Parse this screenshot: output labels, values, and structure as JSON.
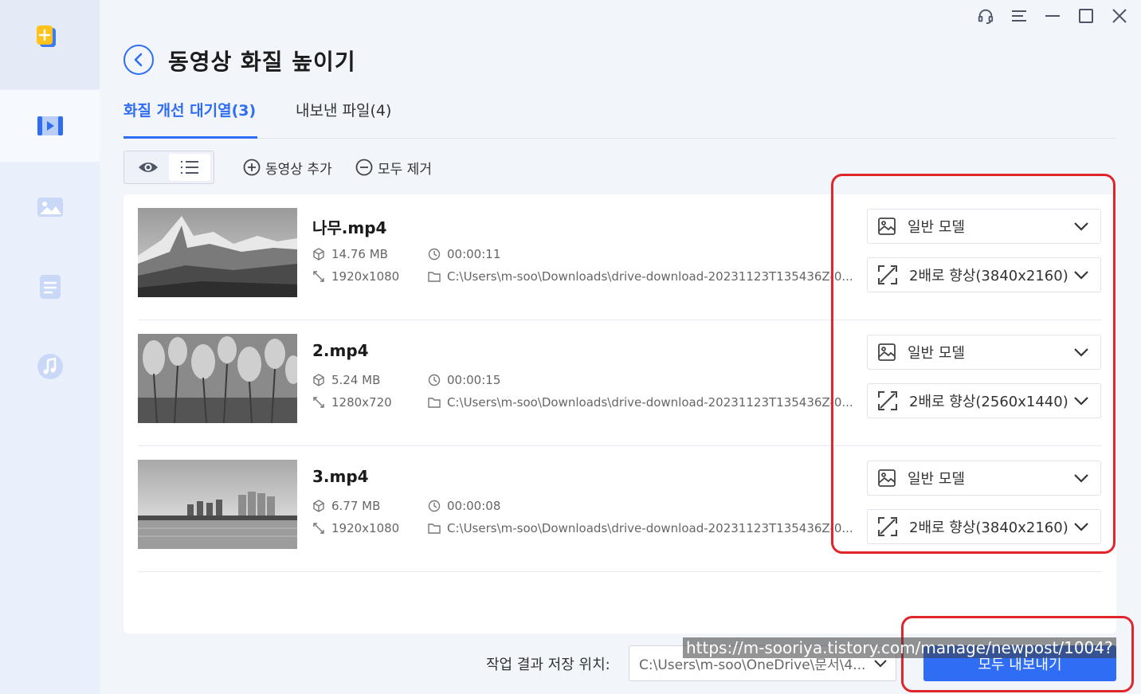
{
  "page": {
    "title": "동영상 화질 높이기",
    "tabs": [
      {
        "label": "화질 개선 대기열(3)",
        "active": true
      },
      {
        "label": "내보낸 파일(4)",
        "active": false
      }
    ]
  },
  "toolbar": {
    "add_label": "동영상 추가",
    "remove_label": "모두 제거"
  },
  "queue": [
    {
      "name": "나무.mp4",
      "size": "14.76 MB",
      "resolution": "1920x1080",
      "duration": "00:00:11",
      "path": "C:\\Users\\m-soo\\Downloads\\drive-download-20231123T135436Z-0...",
      "model": "일반 모델",
      "scale": "2배로 향상(3840x2160)"
    },
    {
      "name": "2.mp4",
      "size": "5.24 MB",
      "resolution": "1280x720",
      "duration": "00:00:15",
      "path": "C:\\Users\\m-soo\\Downloads\\drive-download-20231123T135436Z-0...",
      "model": "일반 모델",
      "scale": "2배로 향상(2560x1440)"
    },
    {
      "name": "3.mp4",
      "size": "6.77 MB",
      "resolution": "1920x1080",
      "duration": "00:00:08",
      "path": "C:\\Users\\m-soo\\Downloads\\drive-download-20231123T135436Z-0...",
      "model": "일반 모델",
      "scale": "2배로 향상(3840x2160)"
    }
  ],
  "footer": {
    "save_label": "작업 결과 저장 위치:",
    "save_path": "C:\\Users\\m-soo\\OneDrive\\문서\\4...",
    "export_label": "모두 내보내기"
  },
  "watermark": "https://m-sooriya.tistory.com/manage/newpost/1004?",
  "colors": {
    "accent": "#2f6df5",
    "annotation": "#e0262b"
  }
}
